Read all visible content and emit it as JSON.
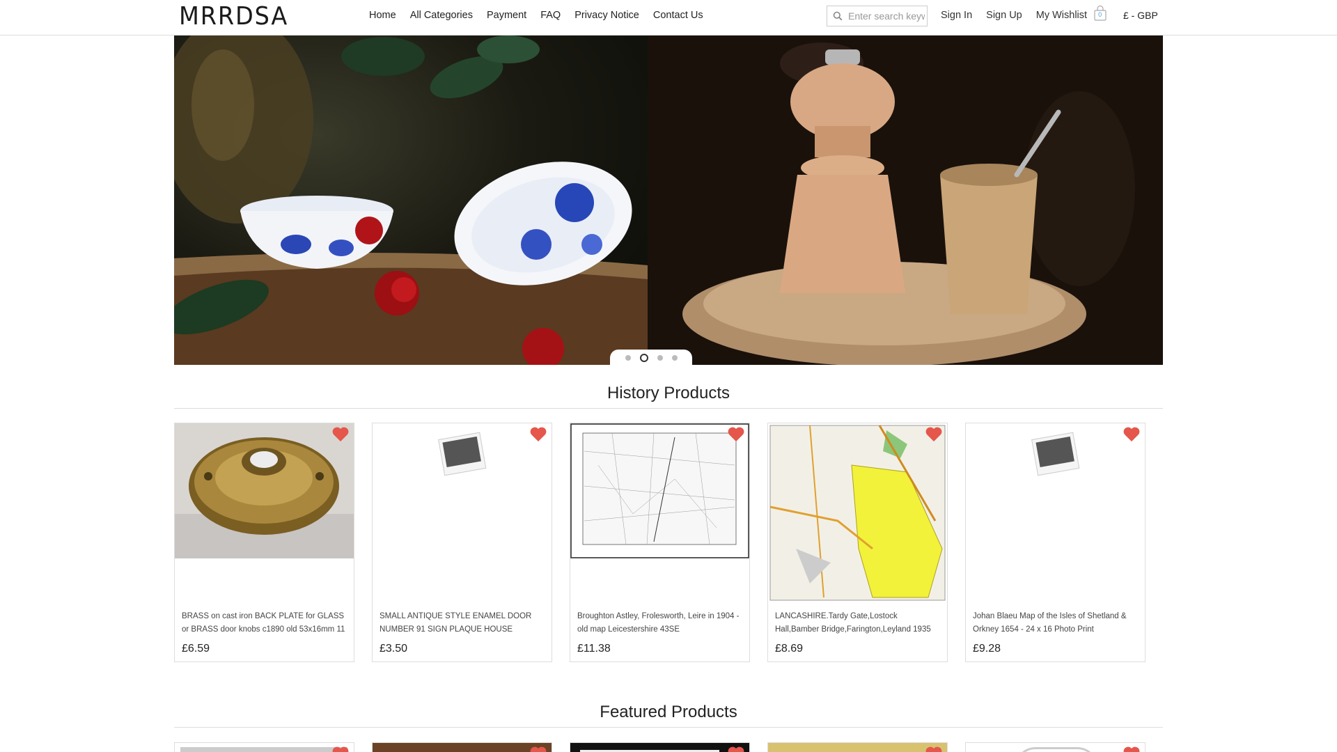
{
  "header": {
    "logo": "MRRDSA",
    "nav": [
      "Home",
      "All Categories",
      "Payment",
      "FAQ",
      "Privacy Notice",
      "Contact Us"
    ],
    "search_placeholder": "Enter search keywords",
    "sign_in": "Sign In",
    "sign_up": "Sign Up",
    "wishlist": "My Wishlist",
    "cart_count": "0",
    "currency": "£ - GBP"
  },
  "carousel": {
    "slides": 4,
    "active_index": 1
  },
  "history": {
    "title": "History Products",
    "products": [
      {
        "title": "BRASS on cast iron BACK PLATE for GLASS or BRASS door knobs c1890 old 53x16mm 11",
        "price": "£6.59",
        "image": "brass-backplate"
      },
      {
        "title": "SMALL ANTIQUE STYLE ENAMEL DOOR NUMBER 91 SIGN PLAQUE HOUSE",
        "price": "£3.50",
        "image": "placeholder"
      },
      {
        "title": "Broughton Astley, Frolesworth, Leire in 1904 - old map Leicestershire 43SE",
        "price": "£11.38",
        "image": "old-map"
      },
      {
        "title": "LANCASHIRE.Tardy Gate,Lostock Hall,Bamber Bridge,Farington,Leyland 1935",
        "price": "£8.69",
        "image": "colour-map"
      },
      {
        "title": "Johan Blaeu Map of the Isles of Shetland & Orkney 1654 - 24 x 16 Photo Print",
        "price": "£9.28",
        "image": "placeholder"
      }
    ]
  },
  "featured": {
    "title": "Featured Products"
  },
  "colors": {
    "heart": "#e5564b",
    "border": "#dddddd",
    "text": "#222222"
  }
}
